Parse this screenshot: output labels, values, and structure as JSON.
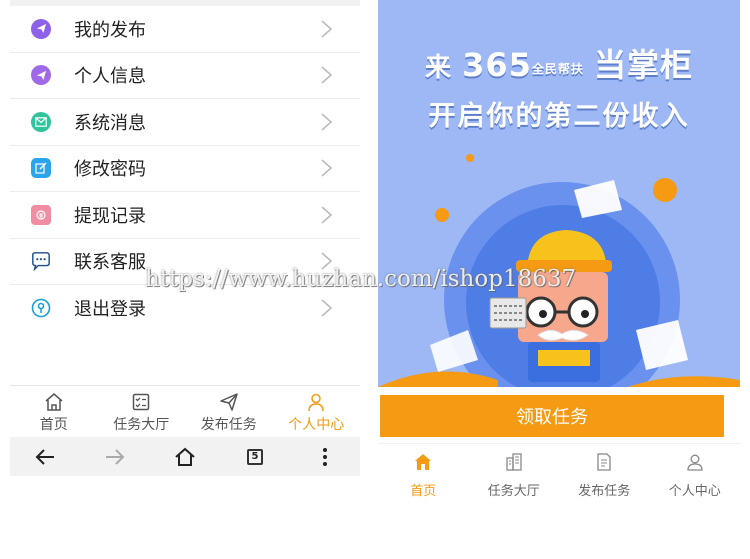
{
  "left_screen": {
    "menu": [
      {
        "label": "我的发布",
        "icon": "send-icon",
        "color": "#8d62e8"
      },
      {
        "label": "个人信息",
        "icon": "send-icon",
        "color": "#a06ae6"
      },
      {
        "label": "系统消息",
        "icon": "mail-icon",
        "color": "#2fc49a"
      },
      {
        "label": "修改密码",
        "icon": "edit-icon",
        "color": "#2ba4ee"
      },
      {
        "label": "提现记录",
        "icon": "wallet-icon",
        "color": "#f08da3"
      },
      {
        "label": "联系客服",
        "icon": "chat-icon",
        "color": "#1f6fb8"
      },
      {
        "label": "退出登录",
        "icon": "key-icon",
        "color": "#1aa0d8"
      }
    ],
    "tabbar": [
      {
        "label": "首页",
        "icon": "home-icon",
        "active": false
      },
      {
        "label": "任务大厅",
        "icon": "task-list-icon",
        "active": false
      },
      {
        "label": "发布任务",
        "icon": "send-icon",
        "active": false
      },
      {
        "label": "个人中心",
        "icon": "user-icon",
        "active": true
      }
    ],
    "browser": {
      "tab_count": "5"
    }
  },
  "right_screen": {
    "banner": {
      "line1_a": "来",
      "line1_num": "365",
      "line1_small": "全民帮扶",
      "line1_b": "当掌柜",
      "line2": "开启你的第二份收入"
    },
    "cta_label": "领取任务",
    "tabbar": [
      {
        "label": "首页",
        "icon": "home-icon",
        "active": true
      },
      {
        "label": "任务大厅",
        "icon": "building-icon",
        "active": false
      },
      {
        "label": "发布任务",
        "icon": "document-icon",
        "active": false
      },
      {
        "label": "个人中心",
        "icon": "user-icon",
        "active": false
      }
    ]
  },
  "watermark": "https://www.huzhan.com/ishop18637",
  "colors": {
    "accent": "#f59a12",
    "banner_bg": "#9db8f4"
  }
}
